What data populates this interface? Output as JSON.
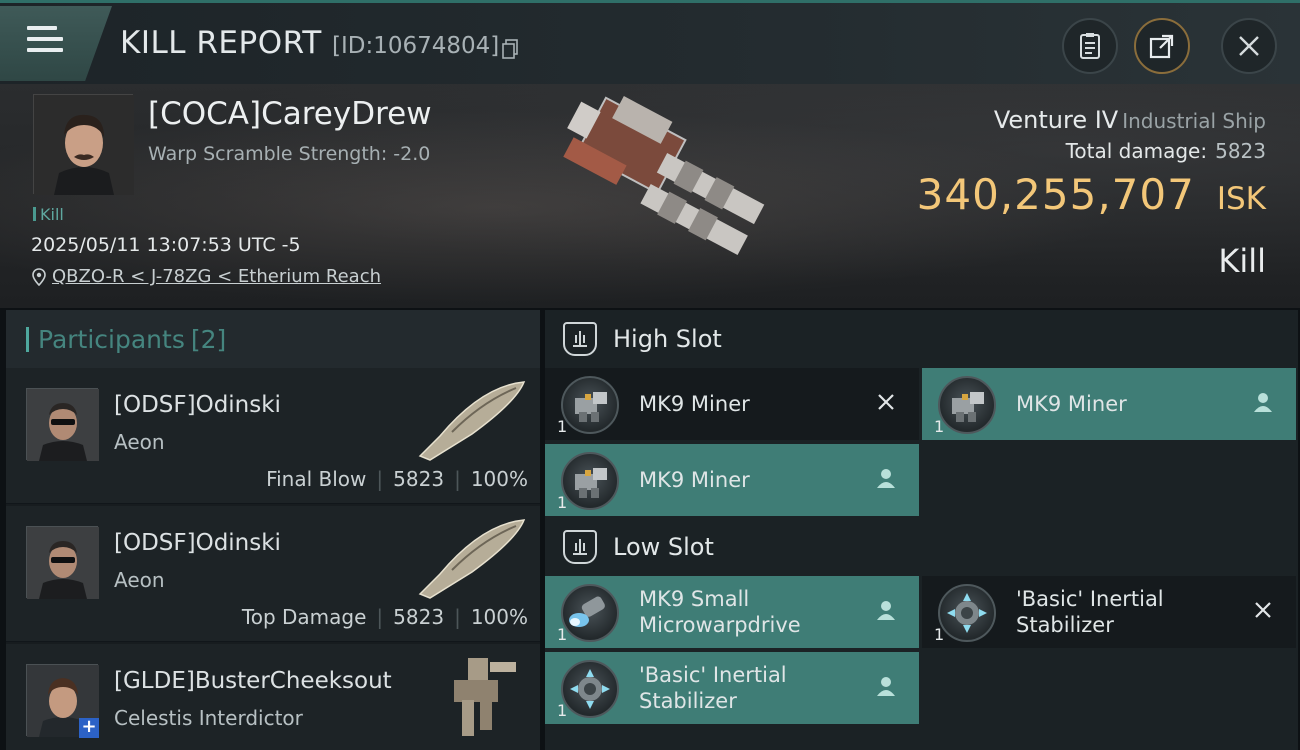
{
  "header": {
    "title": "KILL REPORT",
    "report_id": "[ID:10674804]"
  },
  "victim": {
    "name": "[COCA]CareyDrew",
    "warp_scramble": "Warp Scramble Strength: -2.0",
    "kill_label": "Kill",
    "datetime": "2025/05/11 13:07:53 UTC -5",
    "location": "QBZO-R < J-78ZG < Etherium Reach",
    "ship_name": "Venture IV",
    "ship_class": "Industrial Ship",
    "total_damage_label": "Total damage:",
    "total_damage_value": "5823",
    "isk_value": "340,255,707",
    "isk_unit": "ISK",
    "result": "Kill"
  },
  "participants": {
    "label": "Participants",
    "count": "[2]",
    "items": [
      {
        "name": "[ODSF]Odinski",
        "ship": "Aeon",
        "tag": "Final Blow",
        "damage": "5823",
        "percent": "100%"
      },
      {
        "name": "[ODSF]Odinski",
        "ship": "Aeon",
        "tag": "Top Damage",
        "damage": "5823",
        "percent": "100%"
      },
      {
        "name": "[GLDE]BusterCheeksout",
        "ship": "Celestis Interdictor"
      }
    ]
  },
  "fitting": {
    "high_slot_label": "High Slot",
    "low_slot_label": "Low Slot",
    "high": [
      {
        "name": "MK9 Miner",
        "qty": "1",
        "status": "destroyed"
      },
      {
        "name": "MK9 Miner",
        "qty": "1",
        "status": "dropped"
      },
      {
        "name": "MK9 Miner",
        "qty": "1",
        "status": "dropped"
      }
    ],
    "low": [
      {
        "name_line1": "MK9 Small",
        "name_line2": "Microwarpdrive",
        "qty": "1",
        "status": "dropped"
      },
      {
        "name_line1": "'Basic' Inertial",
        "name_line2": "Stabilizer",
        "qty": "1",
        "status": "destroyed"
      },
      {
        "name_line1": "'Basic' Inertial",
        "name_line2": "Stabilizer",
        "qty": "1",
        "status": "dropped"
      }
    ]
  },
  "colors": {
    "accent_teal": "#3f7d76",
    "isk_gold": "#f3c779",
    "participants_label": "#45857f"
  }
}
